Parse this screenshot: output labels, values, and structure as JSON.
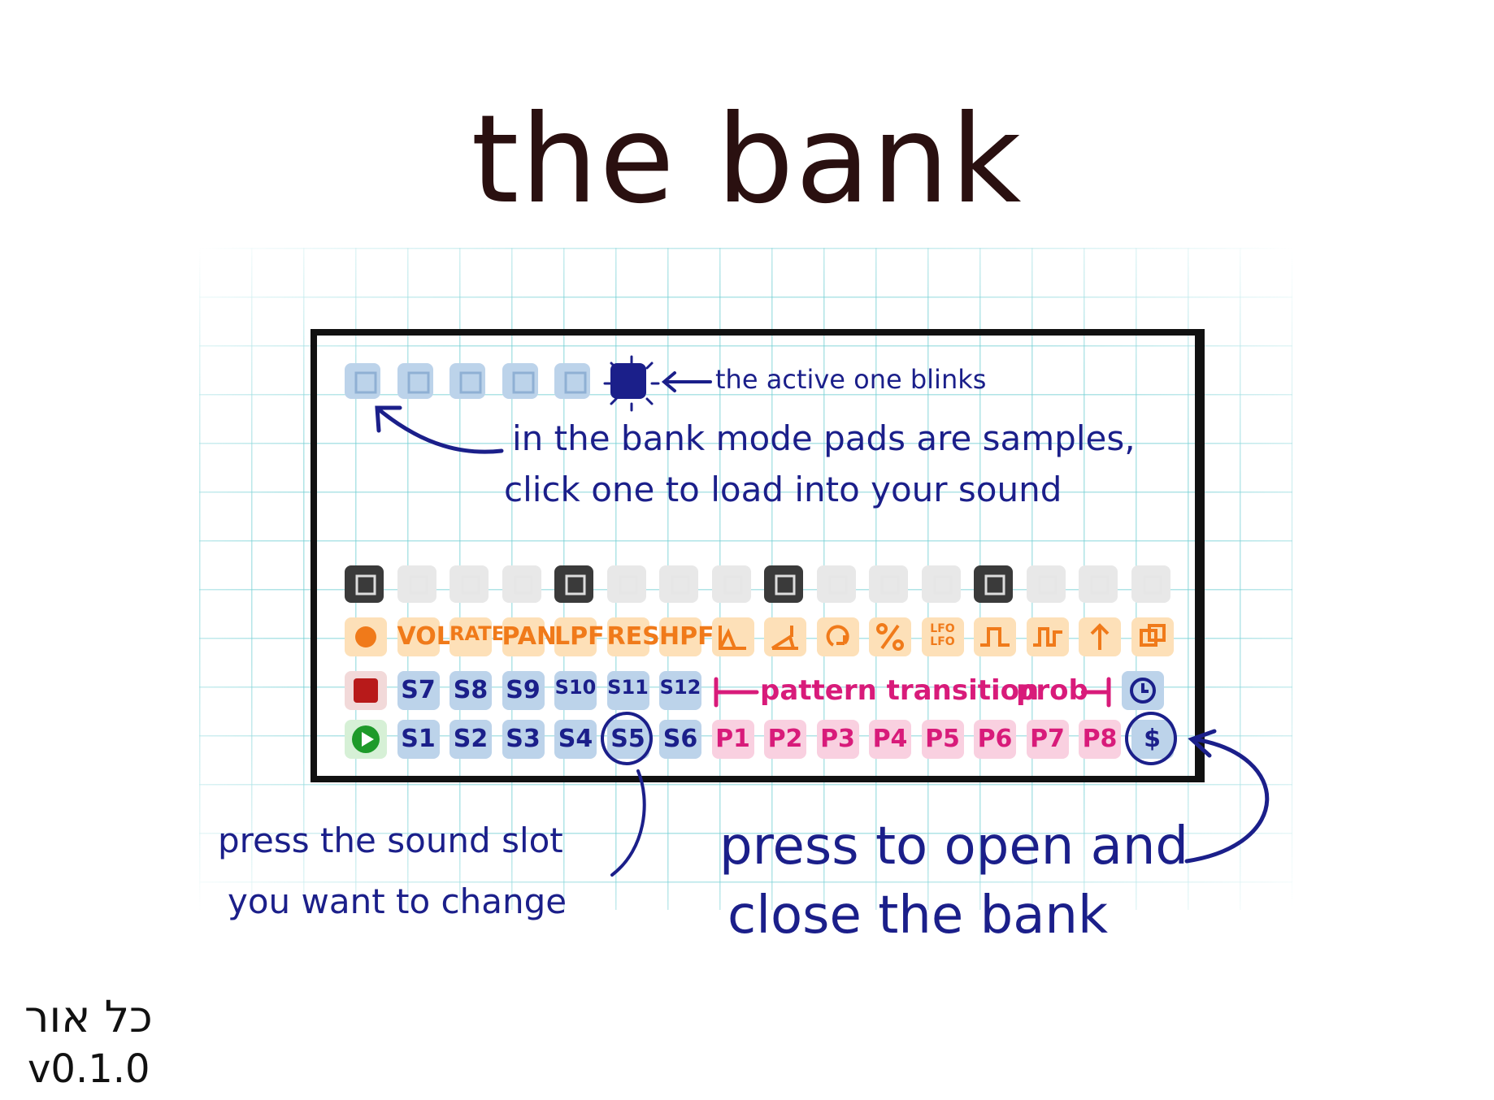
{
  "title": "the bank",
  "annotations": {
    "active_blinks": "the active one blinks",
    "bank_mode_line1": "in the bank mode pads are samples,",
    "bank_mode_line2": "click one to load into your sound",
    "sound_slot_line1": "press the sound slot",
    "sound_slot_line2": "you want to change",
    "open_close_line1": "press to open and",
    "open_close_line2": "close the bank"
  },
  "signature": {
    "name": "כל אור",
    "version": "v0.1.0"
  },
  "colors": {
    "ink": "#1b1f8a",
    "title": "#2a1010",
    "orange": "#f07a1a",
    "orange_bg": "#fde0b8",
    "magenta": "#d81b7a",
    "magenta_bg": "#f9d0e0",
    "blue_bg": "#bcd3ea",
    "grid": "#6ecdd2"
  },
  "sample_row": [
    {
      "icon": "sample-pad-icon",
      "state": "inactive"
    },
    {
      "icon": "sample-pad-icon",
      "state": "inactive"
    },
    {
      "icon": "sample-pad-icon",
      "state": "inactive"
    },
    {
      "icon": "sample-pad-icon",
      "state": "inactive"
    },
    {
      "icon": "sample-pad-icon",
      "state": "inactive"
    },
    {
      "icon": "sample-pad-icon",
      "state": "active"
    }
  ],
  "top_row": [
    {
      "icon": "dark-pad-icon",
      "state": "dark"
    },
    {
      "icon": "light-pad-icon",
      "state": "light"
    },
    {
      "icon": "light-pad-icon",
      "state": "light"
    },
    {
      "icon": "light-pad-icon",
      "state": "light"
    },
    {
      "icon": "dark-pad-icon",
      "state": "dark"
    },
    {
      "icon": "light-pad-icon",
      "state": "light"
    },
    {
      "icon": "light-pad-icon",
      "state": "light"
    },
    {
      "icon": "light-pad-icon",
      "state": "light"
    },
    {
      "icon": "dark-pad-icon",
      "state": "dark"
    },
    {
      "icon": "light-pad-icon",
      "state": "light"
    },
    {
      "icon": "light-pad-icon",
      "state": "light"
    },
    {
      "icon": "light-pad-icon",
      "state": "light"
    },
    {
      "icon": "dark-pad-icon",
      "state": "dark"
    },
    {
      "icon": "light-pad-icon",
      "state": "light"
    },
    {
      "icon": "light-pad-icon",
      "state": "light"
    },
    {
      "icon": "light-pad-icon",
      "state": "light"
    }
  ],
  "param_row": [
    {
      "type": "icon",
      "icon": "record-dot-icon"
    },
    {
      "type": "text",
      "label": "VOL"
    },
    {
      "type": "text",
      "label": "RATE"
    },
    {
      "type": "text",
      "label": "PAN"
    },
    {
      "type": "text",
      "label": "LPF"
    },
    {
      "type": "text",
      "label": "RES"
    },
    {
      "type": "text",
      "label": "HPF"
    },
    {
      "type": "icon",
      "icon": "attack-envelope-icon"
    },
    {
      "type": "icon",
      "icon": "release-envelope-icon"
    },
    {
      "type": "icon",
      "icon": "loop-icon"
    },
    {
      "type": "icon",
      "icon": "percent-icon"
    },
    {
      "type": "text",
      "label": "LFO LFO"
    },
    {
      "type": "icon",
      "icon": "square-wave-icon"
    },
    {
      "type": "icon",
      "icon": "square-wave-alt-icon"
    },
    {
      "type": "icon",
      "icon": "up-arrow-icon"
    },
    {
      "type": "icon",
      "icon": "copy-icon"
    }
  ],
  "sound_row_upper": [
    {
      "type": "icon",
      "icon": "stop-square-icon"
    },
    {
      "type": "text",
      "label": "S7"
    },
    {
      "type": "text",
      "label": "S8"
    },
    {
      "type": "text",
      "label": "S9"
    },
    {
      "type": "text",
      "label": "S10"
    },
    {
      "type": "text",
      "label": "S11"
    },
    {
      "type": "text",
      "label": "S12"
    }
  ],
  "pattern_transition_label": "pattern transition",
  "prob_label": "prob",
  "clock_icon": "clock-icon",
  "sound_row_lower": [
    {
      "type": "icon",
      "icon": "play-triangle-icon"
    },
    {
      "type": "text",
      "label": "S1",
      "bg": "blue"
    },
    {
      "type": "text",
      "label": "S2",
      "bg": "blue"
    },
    {
      "type": "text",
      "label": "S3",
      "bg": "blue"
    },
    {
      "type": "text",
      "label": "S4",
      "bg": "blue"
    },
    {
      "type": "text",
      "label": "S5",
      "bg": "blue",
      "circled": true
    },
    {
      "type": "text",
      "label": "S6",
      "bg": "blue"
    },
    {
      "type": "text",
      "label": "P1",
      "bg": "pink"
    },
    {
      "type": "text",
      "label": "P2",
      "bg": "pink"
    },
    {
      "type": "text",
      "label": "P3",
      "bg": "pink"
    },
    {
      "type": "text",
      "label": "P4",
      "bg": "pink"
    },
    {
      "type": "text",
      "label": "P5",
      "bg": "pink"
    },
    {
      "type": "text",
      "label": "P6",
      "bg": "pink"
    },
    {
      "type": "text",
      "label": "P7",
      "bg": "pink"
    },
    {
      "type": "text",
      "label": "P8",
      "bg": "pink"
    },
    {
      "type": "text",
      "label": "$",
      "bg": "blue",
      "circled": true
    }
  ]
}
